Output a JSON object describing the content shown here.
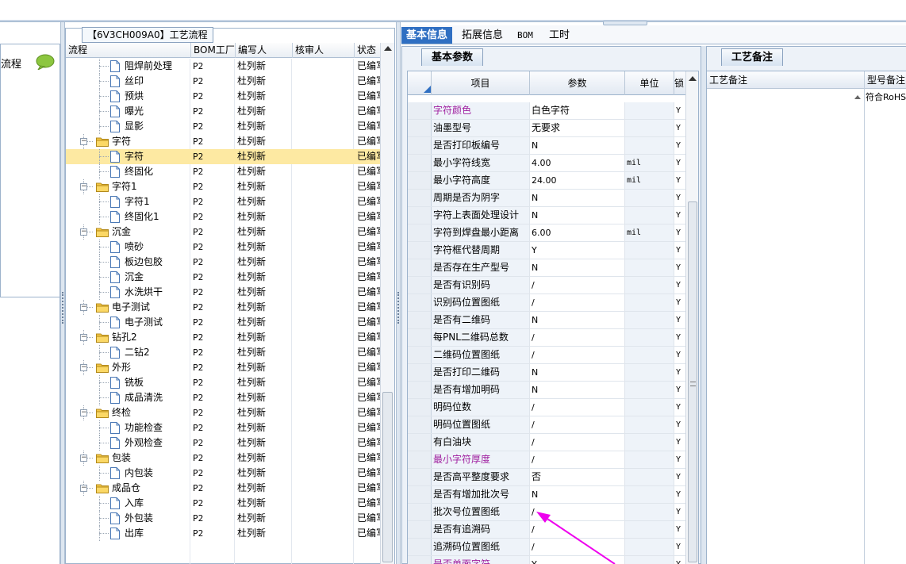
{
  "left_panel": {
    "title": "流程"
  },
  "tree_panel": {
    "tab_label": "【6V3CH009A0】工艺流程",
    "columns": [
      "流程",
      "BOM工厂",
      "编写人",
      "核审人",
      "状态"
    ],
    "rows": [
      {
        "name": "阻焊前处理",
        "level": 1,
        "type": "file",
        "bom": "P2",
        "author": "杜列新",
        "status": "已编写"
      },
      {
        "name": "丝印",
        "level": 1,
        "type": "file",
        "bom": "P2",
        "author": "杜列新",
        "status": "已编写"
      },
      {
        "name": "预烘",
        "level": 1,
        "type": "file",
        "bom": "P2",
        "author": "杜列新",
        "status": "已编写"
      },
      {
        "name": "曝光",
        "level": 1,
        "type": "file",
        "bom": "P2",
        "author": "杜列新",
        "status": "已编写"
      },
      {
        "name": "显影",
        "level": 1,
        "type": "file",
        "bom": "P2",
        "author": "杜列新",
        "status": "已编写"
      },
      {
        "name": "字符",
        "level": 0,
        "type": "folder",
        "bom": "P2",
        "author": "杜列新",
        "status": "已编写"
      },
      {
        "name": "字符",
        "level": 1,
        "type": "file",
        "bom": "P2",
        "author": "杜列新",
        "status": "已编写",
        "selected": true
      },
      {
        "name": "终固化",
        "level": 1,
        "type": "file",
        "bom": "P2",
        "author": "杜列新",
        "status": "已编写"
      },
      {
        "name": "字符1",
        "level": 0,
        "type": "folder",
        "bom": "P2",
        "author": "杜列新",
        "status": "已编写"
      },
      {
        "name": "字符1",
        "level": 1,
        "type": "file",
        "bom": "P2",
        "author": "杜列新",
        "status": "已编写"
      },
      {
        "name": "终固化1",
        "level": 1,
        "type": "file",
        "bom": "P2",
        "author": "杜列新",
        "status": "已编写"
      },
      {
        "name": "沉金",
        "level": 0,
        "type": "folder",
        "bom": "P2",
        "author": "杜列新",
        "status": "已编写"
      },
      {
        "name": "喷砂",
        "level": 1,
        "type": "file",
        "bom": "P2",
        "author": "杜列新",
        "status": "已编写"
      },
      {
        "name": "板边包胶",
        "level": 1,
        "type": "file",
        "bom": "P2",
        "author": "杜列新",
        "status": "已编写"
      },
      {
        "name": "沉金",
        "level": 1,
        "type": "file",
        "bom": "P2",
        "author": "杜列新",
        "status": "已编写"
      },
      {
        "name": "水洗烘干",
        "level": 1,
        "type": "file",
        "bom": "P2",
        "author": "杜列新",
        "status": "已编写"
      },
      {
        "name": "电子测试",
        "level": 0,
        "type": "folder",
        "bom": "P2",
        "author": "杜列新",
        "status": "已编写"
      },
      {
        "name": "电子测试",
        "level": 1,
        "type": "file",
        "bom": "P2",
        "author": "杜列新",
        "status": "已编写"
      },
      {
        "name": "钻孔2",
        "level": 0,
        "type": "folder",
        "bom": "P2",
        "author": "杜列新",
        "status": "已编写"
      },
      {
        "name": "二钻2",
        "level": 1,
        "type": "file",
        "bom": "P2",
        "author": "杜列新",
        "status": "已编写"
      },
      {
        "name": "外形",
        "level": 0,
        "type": "folder",
        "bom": "P2",
        "author": "杜列新",
        "status": "已编写"
      },
      {
        "name": "铣板",
        "level": 1,
        "type": "file",
        "bom": "P2",
        "author": "杜列新",
        "status": "已编写"
      },
      {
        "name": "成品清洗",
        "level": 1,
        "type": "file",
        "bom": "P2",
        "author": "杜列新",
        "status": "已编写"
      },
      {
        "name": "终检",
        "level": 0,
        "type": "folder",
        "bom": "P2",
        "author": "杜列新",
        "status": "已编写"
      },
      {
        "name": "功能检查",
        "level": 1,
        "type": "file",
        "bom": "P2",
        "author": "杜列新",
        "status": "已编写"
      },
      {
        "name": "外观检查",
        "level": 1,
        "type": "file",
        "bom": "P2",
        "author": "杜列新",
        "status": "已编写"
      },
      {
        "name": "包装",
        "level": 0,
        "type": "folder",
        "bom": "P2",
        "author": "杜列新",
        "status": "已编写"
      },
      {
        "name": "内包装",
        "level": 1,
        "type": "file",
        "bom": "P2",
        "author": "杜列新",
        "status": "已编写"
      },
      {
        "name": "成品仓",
        "level": 0,
        "type": "folder",
        "bom": "P2",
        "author": "杜列新",
        "status": "已编写"
      },
      {
        "name": "入库",
        "level": 1,
        "type": "file",
        "bom": "P2",
        "author": "杜列新",
        "status": "已编写"
      },
      {
        "name": "外包装",
        "level": 1,
        "type": "file",
        "bom": "P2",
        "author": "杜列新",
        "status": "已编写"
      },
      {
        "name": "出库",
        "level": 1,
        "type": "file",
        "bom": "P2",
        "author": "杜列新",
        "status": "已编写"
      }
    ]
  },
  "main_tabs": [
    "基本信息",
    "拓展信息",
    "BOM",
    "工时"
  ],
  "basic_params": {
    "subtab": "基本参数",
    "columns": [
      "项目",
      "参数",
      "单位",
      "锁"
    ],
    "rows": [
      {
        "item": "字符颜色",
        "param": "白色字符",
        "unit": "",
        "flag": "Y",
        "purple": true
      },
      {
        "item": "油墨型号",
        "param": "无要求",
        "unit": "",
        "flag": "Y"
      },
      {
        "item": "是否打印板编号",
        "param": "N",
        "unit": "",
        "flag": "Y"
      },
      {
        "item": "最小字符线宽",
        "param": "4.00",
        "unit": "mil",
        "flag": "Y"
      },
      {
        "item": "最小字符高度",
        "param": "24.00",
        "unit": "mil",
        "flag": "Y"
      },
      {
        "item": "周期是否为阴字",
        "param": "N",
        "unit": "",
        "flag": "Y"
      },
      {
        "item": "字符上表面处理设计",
        "param": "N",
        "unit": "",
        "flag": "Y"
      },
      {
        "item": "字符到焊盘最小距离",
        "param": "6.00",
        "unit": "mil",
        "flag": "Y"
      },
      {
        "item": "字符框代替周期",
        "param": "Y",
        "unit": "",
        "flag": "Y"
      },
      {
        "item": "是否存在生产型号",
        "param": "N",
        "unit": "",
        "flag": "Y"
      },
      {
        "item": "是否有识别码",
        "param": "/",
        "unit": "",
        "flag": "Y"
      },
      {
        "item": "识别码位置图纸",
        "param": "/",
        "unit": "",
        "flag": "Y"
      },
      {
        "item": "是否有二维码",
        "param": "N",
        "unit": "",
        "flag": "Y"
      },
      {
        "item": "每PNL二维码总数",
        "param": "/",
        "unit": "",
        "flag": "Y"
      },
      {
        "item": "二维码位置图纸",
        "param": "/",
        "unit": "",
        "flag": "Y"
      },
      {
        "item": "是否打印二维码",
        "param": "N",
        "unit": "",
        "flag": "Y"
      },
      {
        "item": "是否有增加明码",
        "param": "N",
        "unit": "",
        "flag": "Y"
      },
      {
        "item": "明码位数",
        "param": "/",
        "unit": "",
        "flag": "Y"
      },
      {
        "item": "明码位置图纸",
        "param": "/",
        "unit": "",
        "flag": "Y"
      },
      {
        "item": "有白油块",
        "param": "/",
        "unit": "",
        "flag": "Y"
      },
      {
        "item": "最小字符厚度",
        "param": "/",
        "unit": "",
        "flag": "Y",
        "purple": true
      },
      {
        "item": "是否高平整度要求",
        "param": "否",
        "unit": "",
        "flag": "Y"
      },
      {
        "item": "是否有增加批次号",
        "param": "N",
        "unit": "",
        "flag": "Y"
      },
      {
        "item": "批次号位置图纸",
        "param": "/",
        "unit": "",
        "flag": "Y"
      },
      {
        "item": "是否有追溯码",
        "param": "/",
        "unit": "",
        "flag": "Y"
      },
      {
        "item": "追溯码位置图纸",
        "param": "/",
        "unit": "",
        "flag": "Y"
      },
      {
        "item": "是否单面字符",
        "param": "Y",
        "unit": "",
        "flag": "Y",
        "purple": true
      }
    ]
  },
  "process_notes": {
    "subtab": "工艺备注",
    "columns": [
      "工艺备注",
      "型号备注"
    ],
    "model_note": "符合RoHS"
  },
  "colors": {
    "accent": "#2f6fc2",
    "selected_row": "#fde9a2",
    "purple_text": "#a020a0",
    "annotation_arrow": "#ee00ee"
  }
}
